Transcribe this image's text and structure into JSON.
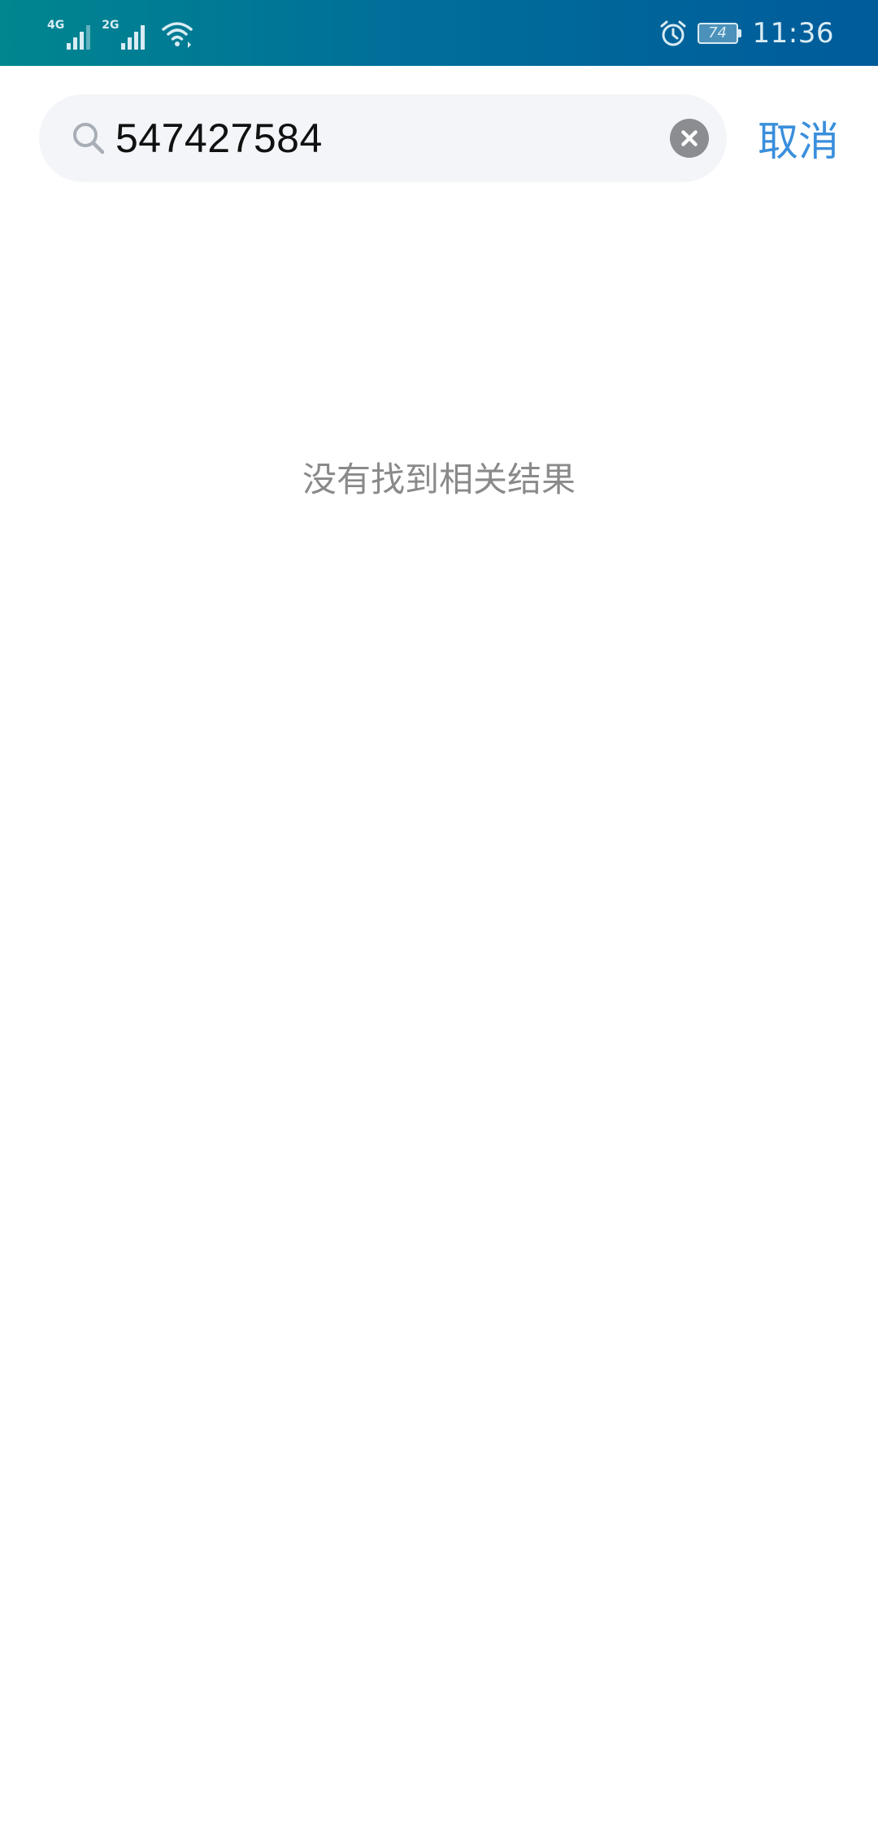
{
  "status_bar": {
    "signal1_label": "4G",
    "signal2_label": "2G",
    "battery_level": "74",
    "time": "11:36",
    "icons": [
      "signal-icon",
      "wifi-icon",
      "alarm-icon",
      "battery-icon"
    ],
    "text_color": "#d9ecf3"
  },
  "search": {
    "value": "547427584",
    "cancel_label": "取消",
    "icons": [
      "search-icon",
      "clear-icon"
    ]
  },
  "results": {
    "empty_message": "没有找到相关结果"
  },
  "colors": {
    "accent": "#3a8fdc",
    "search_bg": "#f3f5f8",
    "muted_text": "#8a8a8a"
  }
}
